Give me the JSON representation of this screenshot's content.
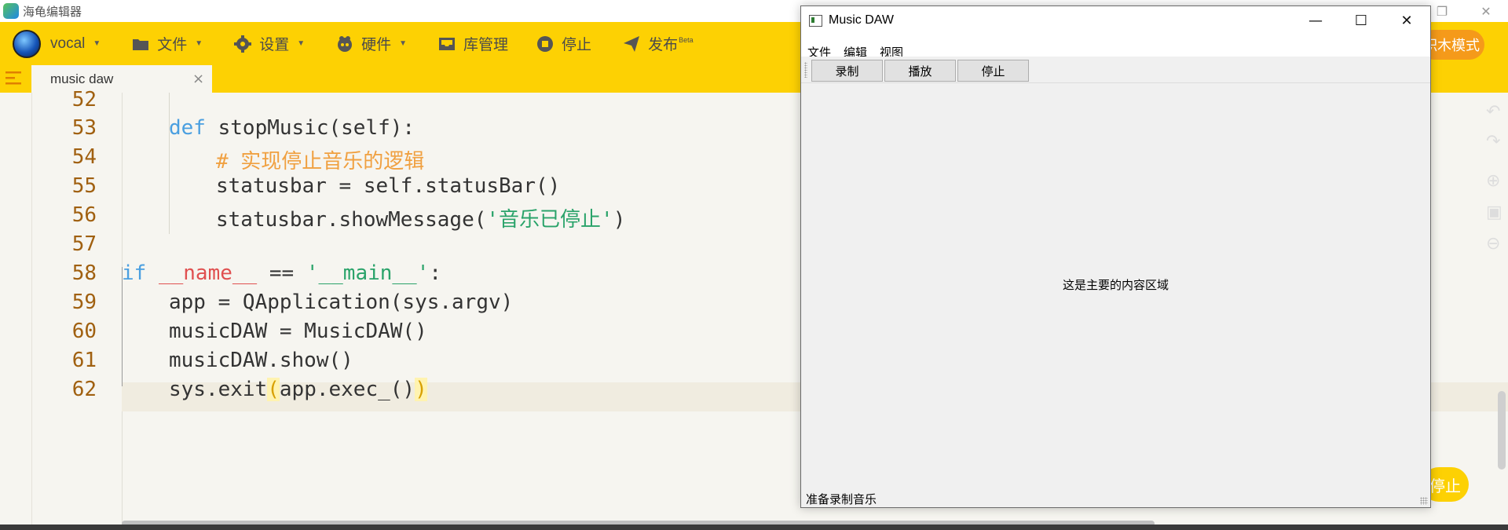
{
  "app": {
    "title": "海龟编辑器"
  },
  "toolbar": {
    "mode_label": "vocal",
    "file_label": "文件",
    "settings_label": "设置",
    "hardware_label": "硬件",
    "library_label": "库管理",
    "stop_label": "停止",
    "publish_label": "发布",
    "publish_badge": "Beta",
    "block_mode_label": "积木模式",
    "accent": "#fdd103"
  },
  "tab": {
    "label": "music daw",
    "close": "×"
  },
  "run_button_label": "停止",
  "code": {
    "lines": [
      {
        "num": "52"
      },
      {
        "num": "53"
      },
      {
        "num": "54"
      },
      {
        "num": "55"
      },
      {
        "num": "56"
      },
      {
        "num": "57"
      },
      {
        "num": "58"
      },
      {
        "num": "59"
      },
      {
        "num": "60"
      },
      {
        "num": "61"
      },
      {
        "num": "62"
      }
    ],
    "l53_kw": "def",
    "l53_rest": " stopMusic(self):",
    "l54": "# 实现停止音乐的逻辑",
    "l55": "statusbar = self.statusBar()",
    "l56_a": "statusbar.showMessage(",
    "l56_str": "'音乐已停止'",
    "l56_b": ")",
    "l58_kw": "if",
    "l58_d1": "__name__",
    "l58_op": " == ",
    "l58_str": "'__main__'",
    "l58_end": ":",
    "l59": "app = QApplication(sys.argv)",
    "l60": "musicDAW = MusicDAW()",
    "l61": "musicDAW.show()",
    "l62_a": "sys.exit",
    "l62_p1": "(",
    "l62_b": "app.exec_()",
    "l62_p2": ")"
  },
  "daw": {
    "title": "Music DAW",
    "menus": [
      "文件",
      "编辑",
      "视图"
    ],
    "buttons": [
      "录制",
      "播放",
      "停止"
    ],
    "content": "这是主要的内容区域",
    "status": "准备录制音乐"
  }
}
